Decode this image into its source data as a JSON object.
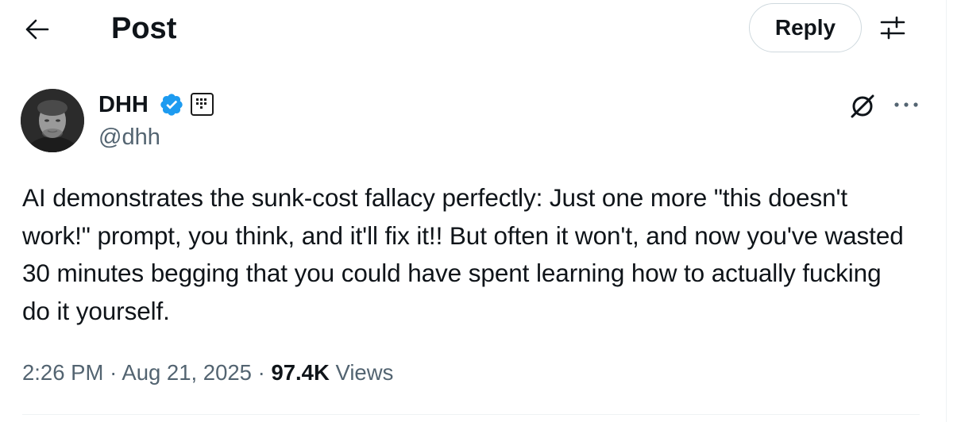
{
  "header": {
    "title": "Post",
    "back_icon": "arrow-left-icon",
    "reply_label": "Reply",
    "filter_icon": "sliders-icon"
  },
  "author": {
    "name": "DHH",
    "handle": "@dhh",
    "verified_icon": "verified-badge-icon",
    "affiliation_icon": "affiliate-badge-icon"
  },
  "actions": {
    "grok_icon": "grok-icon",
    "more_icon": "more-icon"
  },
  "post": {
    "text": "AI demonstrates the sunk-cost fallacy perfectly: Just one more \"this doesn't work!\" prompt, you think, and it'll fix it!! But often it won't, and now you've wasted 30 minutes begging that you could have spent learning how to actually fucking do it yourself.",
    "time": "2:26 PM",
    "separator": "·",
    "date": "Aug 21, 2025",
    "views_count": "97.4K",
    "views_label": "Views"
  },
  "colors": {
    "text": "#0f1419",
    "secondary": "#536471",
    "verified": "#1d9bf0",
    "border": "#cfd9de"
  }
}
